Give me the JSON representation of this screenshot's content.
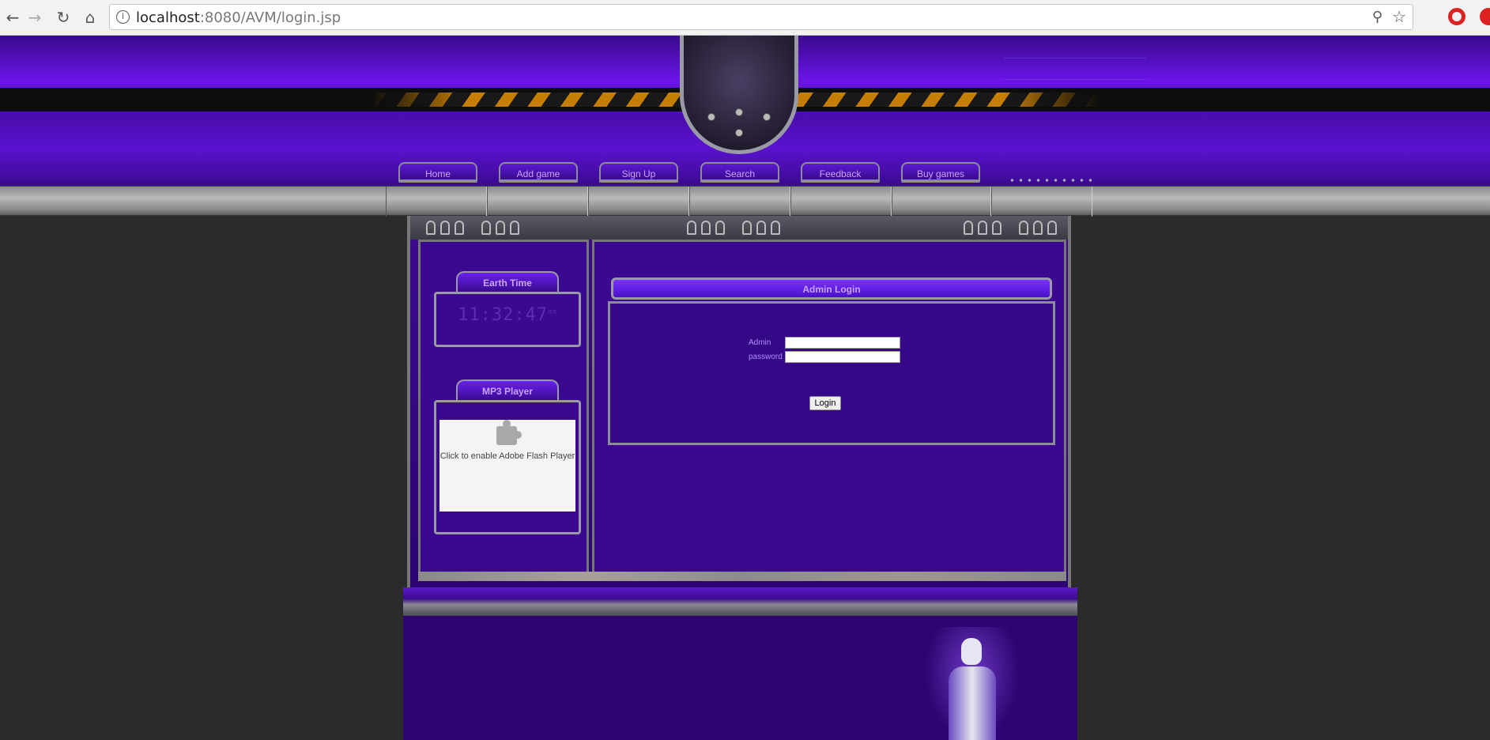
{
  "browser": {
    "url_host": "localhost",
    "url_rest": ":8080/AVM/login.jsp",
    "icons": [
      "back-arrow-icon",
      "forward-arrow-icon",
      "reload-icon",
      "home-icon",
      "info-icon",
      "zoom-icon",
      "star-icon",
      "opera-icon"
    ]
  },
  "nav": {
    "items": [
      {
        "label": "Home"
      },
      {
        "label": "Add game"
      },
      {
        "label": "Sign Up"
      },
      {
        "label": "Search"
      },
      {
        "label": "Feedback"
      },
      {
        "label": "Buy games"
      }
    ]
  },
  "sidebar": {
    "clock": {
      "title": "Earth Time",
      "time": "11:32:47",
      "ampm": "am"
    },
    "mp3": {
      "title": "MP3 Player",
      "flash_message": "Click to enable Adobe Flash Player"
    }
  },
  "login": {
    "title": "Admin Login",
    "admin_label": "Admin",
    "password_label": "password",
    "admin_value": "",
    "password_value": "",
    "button_label": "Login"
  },
  "colors": {
    "accent": "#5a12d0",
    "dark": "#2e0570",
    "label": "#b48cff"
  }
}
